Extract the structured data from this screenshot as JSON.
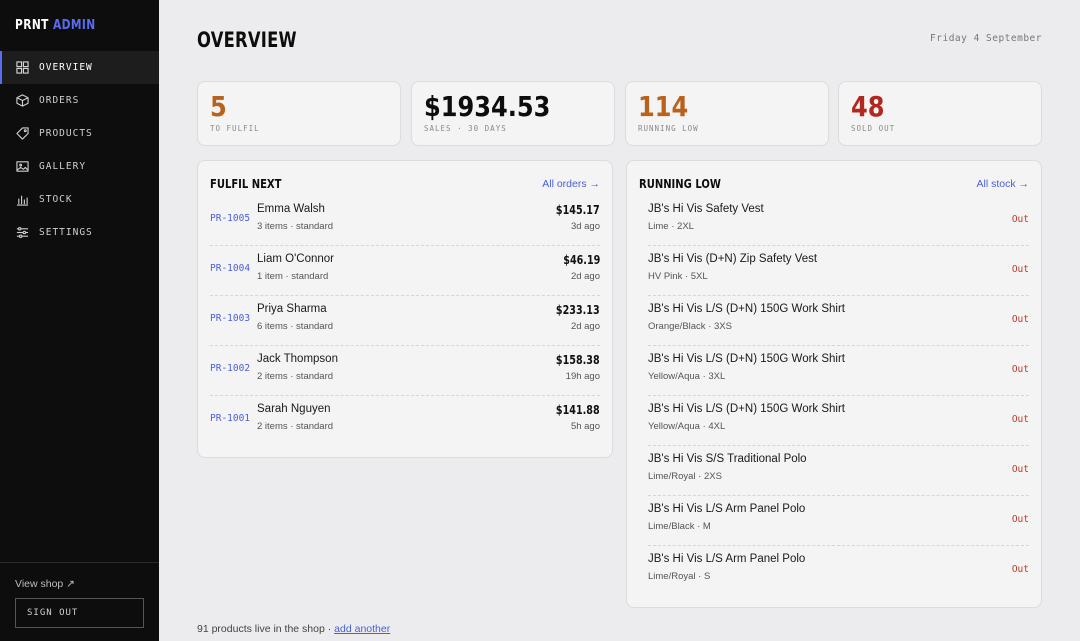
{
  "brand": {
    "part1": "PRNT",
    "part2": "ADMIN"
  },
  "colors": {
    "accent": "#5a6cf2",
    "link": "#4a5fd9",
    "orange": "#b8621b",
    "red": "#b0281f",
    "sidebar_bg": "#0d0d0d"
  },
  "sidebar": {
    "items": [
      {
        "label": "OVERVIEW",
        "icon": "grid-icon",
        "active": true
      },
      {
        "label": "ORDERS",
        "icon": "box-icon",
        "active": false
      },
      {
        "label": "PRODUCTS",
        "icon": "tag-icon",
        "active": false
      },
      {
        "label": "GALLERY",
        "icon": "image-icon",
        "active": false
      },
      {
        "label": "STOCK",
        "icon": "bar-chart-icon",
        "active": false
      },
      {
        "label": "SETTINGS",
        "icon": "sliders-icon",
        "active": false
      }
    ],
    "view_shop": "View shop ↗",
    "sign_out": "SIGN OUT"
  },
  "header": {
    "title": "OVERVIEW",
    "date": "Friday 4 September"
  },
  "stats": [
    {
      "value": "5",
      "caption": "TO FULFIL",
      "color": "#b8621b"
    },
    {
      "value": "$1934.53",
      "caption": "SALES · 30 DAYS",
      "color": "#0d0d0d"
    },
    {
      "value": "114",
      "caption": "RUNNING LOW",
      "color": "#b8621b"
    },
    {
      "value": "48",
      "caption": "SOLD OUT",
      "color": "#b0281f"
    }
  ],
  "fulfil": {
    "title": "FULFIL NEXT",
    "link": "All orders →",
    "orders": [
      {
        "id": "PR-1005",
        "name": "Emma Walsh",
        "meta": "3 items · standard",
        "amount": "$145.17",
        "ago": "3d ago"
      },
      {
        "id": "PR-1004",
        "name": "Liam O'Connor",
        "meta": "1 item · standard",
        "amount": "$46.19",
        "ago": "2d ago"
      },
      {
        "id": "PR-1003",
        "name": "Priya Sharma",
        "meta": "6 items · standard",
        "amount": "$233.13",
        "ago": "2d ago"
      },
      {
        "id": "PR-1002",
        "name": "Jack Thompson",
        "meta": "2 items · standard",
        "amount": "$158.38",
        "ago": "19h ago"
      },
      {
        "id": "PR-1001",
        "name": "Sarah Nguyen",
        "meta": "2 items · standard",
        "amount": "$141.88",
        "ago": "5h ago"
      }
    ]
  },
  "running_low": {
    "title": "RUNNING LOW",
    "link": "All stock →",
    "items": [
      {
        "name": "JB's Hi Vis Safety Vest",
        "meta": "Lime · 2XL",
        "status": "Out"
      },
      {
        "name": "JB's Hi Vis (D+N) Zip Safety Vest",
        "meta": "HV Pink · 5XL",
        "status": "Out"
      },
      {
        "name": "JB's Hi Vis L/S (D+N) 150G Work Shirt",
        "meta": "Orange/Black · 3XS",
        "status": "Out"
      },
      {
        "name": "JB's Hi Vis L/S (D+N) 150G Work Shirt",
        "meta": "Yellow/Aqua · 3XL",
        "status": "Out"
      },
      {
        "name": "JB's Hi Vis L/S (D+N) 150G Work Shirt",
        "meta": "Yellow/Aqua · 4XL",
        "status": "Out"
      },
      {
        "name": "JB's Hi Vis S/S Traditional Polo",
        "meta": "Lime/Royal · 2XS",
        "status": "Out"
      },
      {
        "name": "JB's Hi Vis L/S Arm Panel Polo",
        "meta": "Lime/Black · M",
        "status": "Out"
      },
      {
        "name": "JB's Hi Vis L/S Arm Panel Polo",
        "meta": "Lime/Royal · S",
        "status": "Out"
      }
    ]
  },
  "footer": {
    "text": "91 products live in the shop · ",
    "link": "add another"
  }
}
